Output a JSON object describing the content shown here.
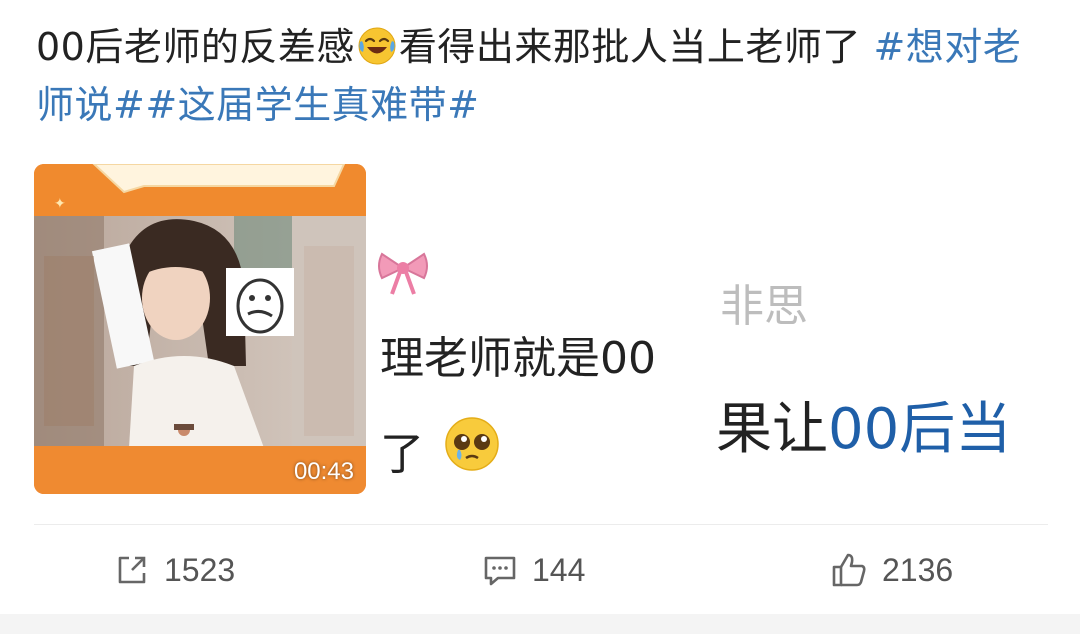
{
  "post": {
    "text_plain_1": "00后老师的反差感",
    "emoji_1": "laughing-crying-emoji",
    "text_plain_2": "看得出来那批人当上老师了 ",
    "hashtag_1": "#想对老师说#",
    "hashtag_2": "#这届学生真难带#"
  },
  "media": {
    "video_duration": "00:43",
    "overlay_line_1": "理老师就是00",
    "overlay_line_2": "了",
    "overlay_faint": "非思",
    "overlay_line_3_black": "果让",
    "overlay_line_3_blue": "00后当",
    "colors": {
      "video_band": "#f08a2e",
      "blue_text": "#1f5fa8"
    }
  },
  "actions": {
    "repost_count": "1523",
    "comment_count": "144",
    "like_count": "2136"
  },
  "colors": {
    "hashtag": "#3a78b8",
    "text": "#222222",
    "action_text": "#555555"
  }
}
